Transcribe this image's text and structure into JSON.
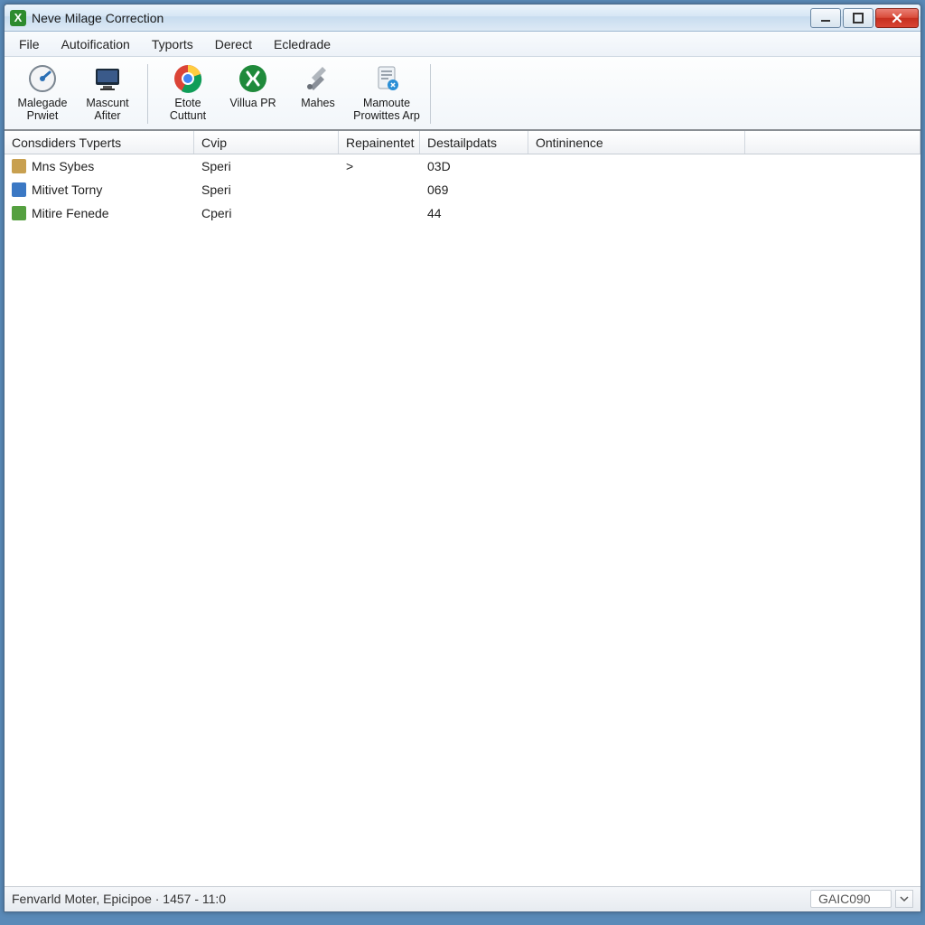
{
  "window": {
    "title": "Neve Milage Correction"
  },
  "menus": [
    {
      "label": "File"
    },
    {
      "label": "Autoification"
    },
    {
      "label": "Tyports"
    },
    {
      "label": "Derect"
    },
    {
      "label": "Ecledrade"
    }
  ],
  "toolbar": [
    {
      "id": "malegade-prwiet",
      "label": "Malegade Prwiet",
      "icon": "gauge"
    },
    {
      "id": "mascunt-afiter",
      "label": "Mascunt Afiter",
      "icon": "monitor"
    },
    {
      "id": "sep"
    },
    {
      "id": "etote-cutunt",
      "label": "Etote Cuttunt",
      "icon": "chrome"
    },
    {
      "id": "villua-pr",
      "label": "Villua PR",
      "icon": "excel"
    },
    {
      "id": "mahes",
      "label": "Mahes",
      "icon": "tools"
    },
    {
      "id": "mamoute-prowites-arp",
      "label": "Mamoute Prowittes Arp",
      "icon": "doc-edit"
    }
  ],
  "columns": [
    {
      "key": "cons",
      "label": "Consdiders Tvperts"
    },
    {
      "key": "cvip",
      "label": "Cvip"
    },
    {
      "key": "repain",
      "label": "Repainentet"
    },
    {
      "key": "desta",
      "label": "Destailpdats"
    },
    {
      "key": "ontin",
      "label": "Ontininence"
    },
    {
      "key": "blank",
      "label": ""
    }
  ],
  "rows": [
    {
      "icon_color": "#c8a050",
      "cons": "Mns Sybes",
      "cvip": "Speri",
      "repain": ">",
      "desta": "03D",
      "ontin": ""
    },
    {
      "icon_color": "#3b78c4",
      "cons": "Mitivet Torny",
      "cvip": "Speri",
      "repain": "",
      "desta": "069",
      "ontin": ""
    },
    {
      "icon_color": "#55a040",
      "cons": "Mitire Fenede",
      "cvip": "Cperi",
      "repain": "",
      "desta": "44",
      "ontin": ""
    }
  ],
  "statusbar": {
    "left": "Fenvarld Moter, Epicipoe · 1457 - 11:0",
    "right_field": "GAIC090"
  }
}
